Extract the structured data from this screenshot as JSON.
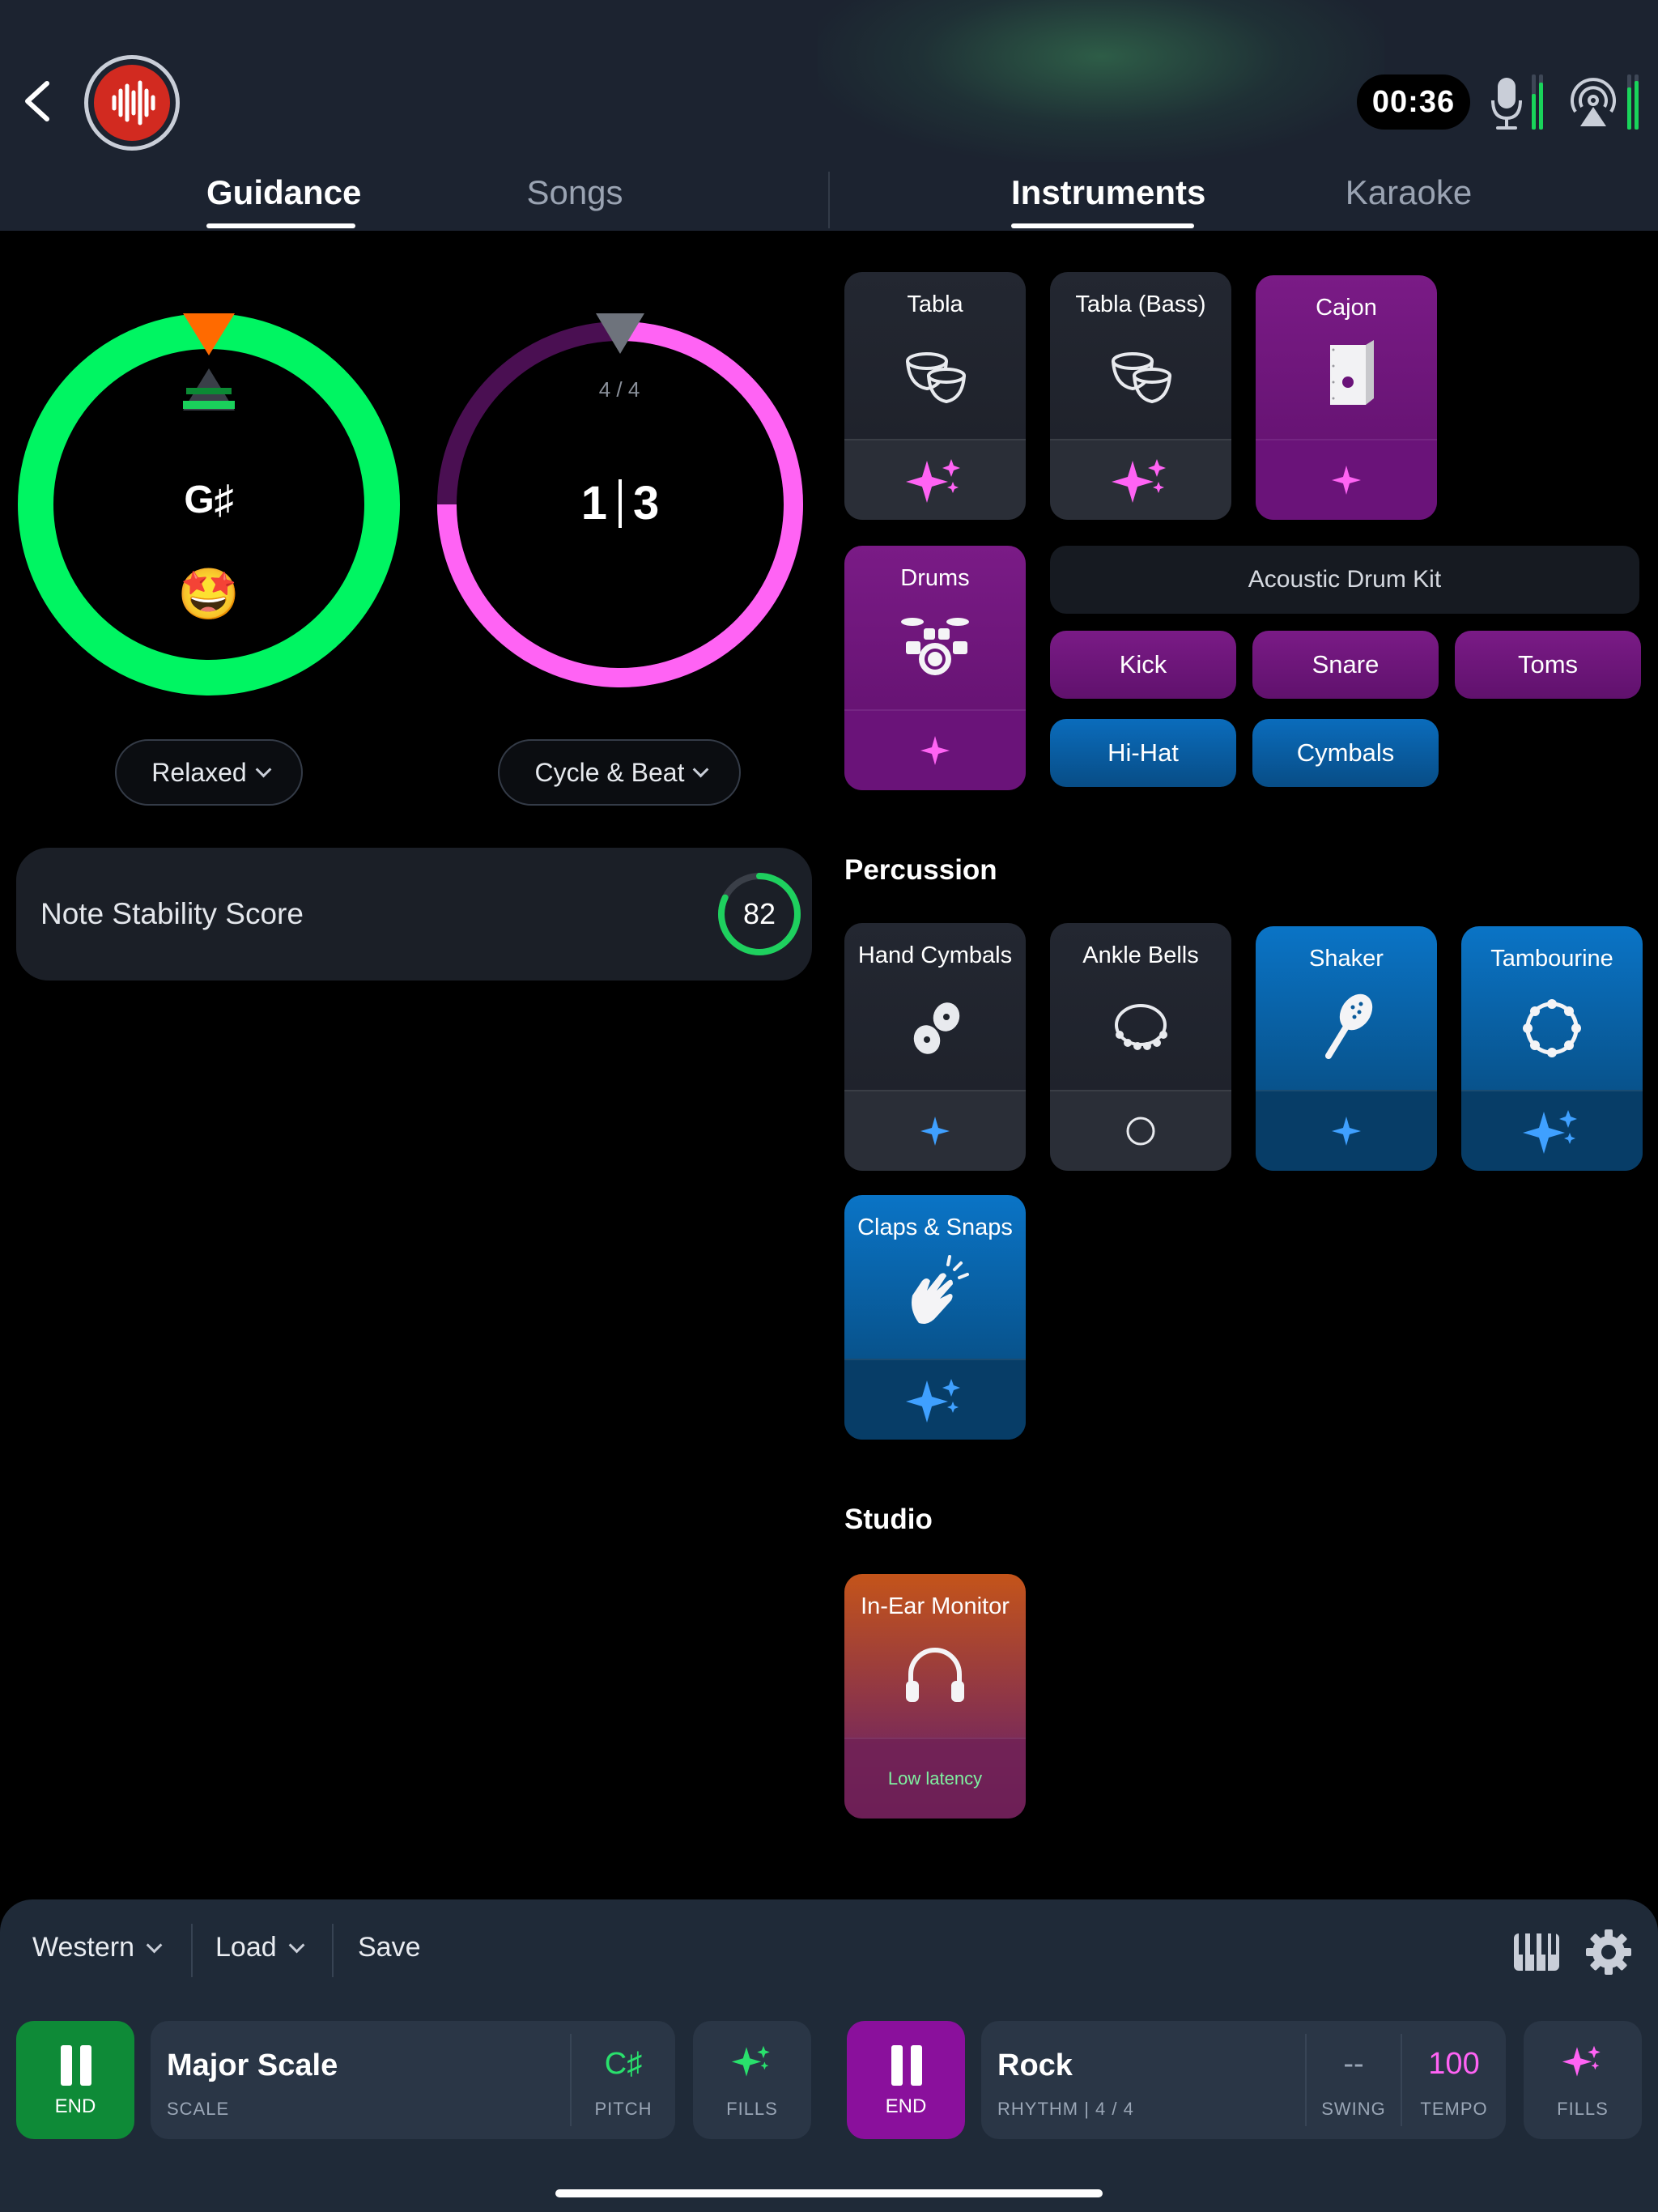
{
  "header": {
    "timer": "00:36",
    "tabs_left": [
      "Guidance",
      "Songs"
    ],
    "tabs_right": [
      "Instruments",
      "Karaoke"
    ],
    "active_left": "Guidance",
    "active_right": "Instruments"
  },
  "guidance": {
    "pitch_note": "G♯",
    "pitch_mood": "🤩",
    "pitch_mode": "Relaxed",
    "beat_signature": "4 / 4",
    "beat_cycle": "1",
    "beat_number": "3",
    "beat_mode": "Cycle & Beat",
    "stability_label": "Note Stability Score",
    "stability_score": "82",
    "stability_fraction": 0.82
  },
  "instruments": {
    "rhythm": {
      "tabla": "Tabla",
      "tabla_bass": "Tabla (Bass)",
      "cajon": "Cajon",
      "drums": "Drums",
      "kit_name": "Acoustic Drum Kit",
      "kick": "Kick",
      "snare": "Snare",
      "toms": "Toms",
      "hihat": "Hi-Hat",
      "cymbals": "Cymbals"
    },
    "percussion": {
      "title": "Percussion",
      "hand_cymbals": "Hand Cymbals",
      "ankle_bells": "Ankle Bells",
      "shaker": "Shaker",
      "tambourine": "Tambourine",
      "claps": "Claps & Snaps"
    },
    "studio": {
      "title": "Studio",
      "in_ear": "In-Ear Monitor",
      "in_ear_note": "Low latency"
    }
  },
  "bottom": {
    "style": "Western",
    "load": "Load",
    "save": "Save",
    "scale_end": "END",
    "scale_name": "Major Scale",
    "scale_caption": "SCALE",
    "pitch_value": "C♯",
    "pitch_caption": "PITCH",
    "fills_caption": "FILLS",
    "rhythm_end": "END",
    "rhythm_name": "Rock",
    "rhythm_caption": "RHYTHM  |  4 / 4",
    "swing_value": "--",
    "swing_caption": "SWING",
    "tempo_value": "100",
    "tempo_caption": "TEMPO",
    "fills_caption_2": "FILLS"
  },
  "colors": {
    "pitch_ring": "#00f562",
    "beat_ring": "#ff63f4",
    "purple_tile": "#7a1b86",
    "blue_tile": "#0a74c6",
    "scale_green": "#0e8a37",
    "rhythm_purple": "#8a109c",
    "tempo_pink": "#ff63f4",
    "pitch_green": "#29e06c"
  }
}
